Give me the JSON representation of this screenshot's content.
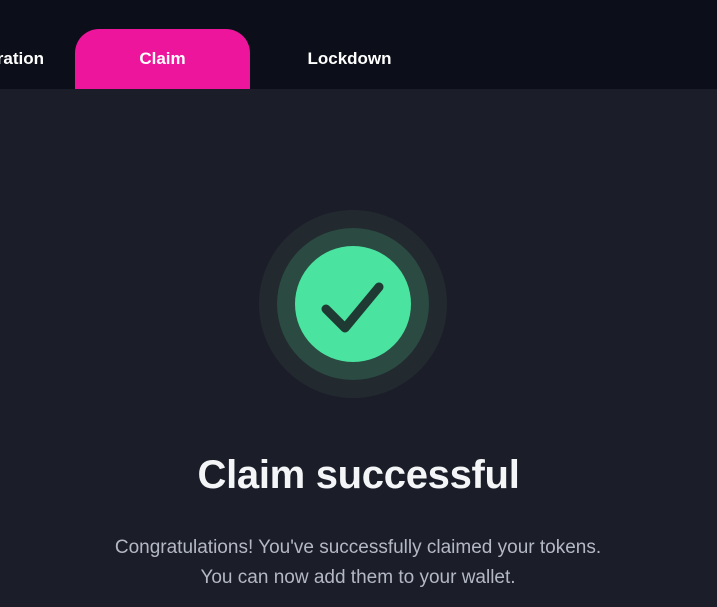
{
  "tabs": [
    {
      "label": "ration",
      "active": false
    },
    {
      "label": "Claim",
      "active": true
    },
    {
      "label": "Lockdown",
      "active": false
    }
  ],
  "success": {
    "icon": "checkmark-icon",
    "title": "Claim successful",
    "message": "Congratulations! You've successfully claimed your tokens. You can now add them to your wallet."
  },
  "colors": {
    "tab_active": "#ec159c",
    "tab_bar": "#0c0f19",
    "background": "#1b1e29",
    "success_green": "#4ae3a0",
    "check_dark": "#1f3a33"
  }
}
